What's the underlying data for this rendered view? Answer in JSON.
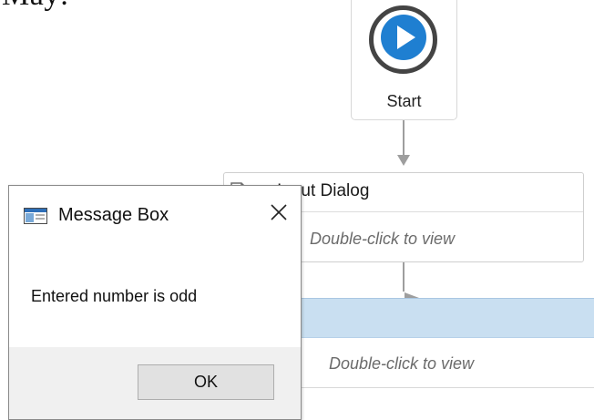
{
  "cropped_heading": "May:",
  "start": {
    "label": "Start",
    "icon": "play-icon",
    "accent": "#1f7fd1"
  },
  "input_activity": {
    "title": "Input Dialog",
    "hint": "Double-click to view",
    "icon": "document-icon"
  },
  "sequence": {
    "hint": "Double-click to view",
    "header_color": "#c9dff1"
  },
  "message_box": {
    "title": "Message Box",
    "message": "Entered number is odd",
    "ok_label": "OK",
    "close_icon": "close-icon",
    "app_icon": "window-icon"
  }
}
